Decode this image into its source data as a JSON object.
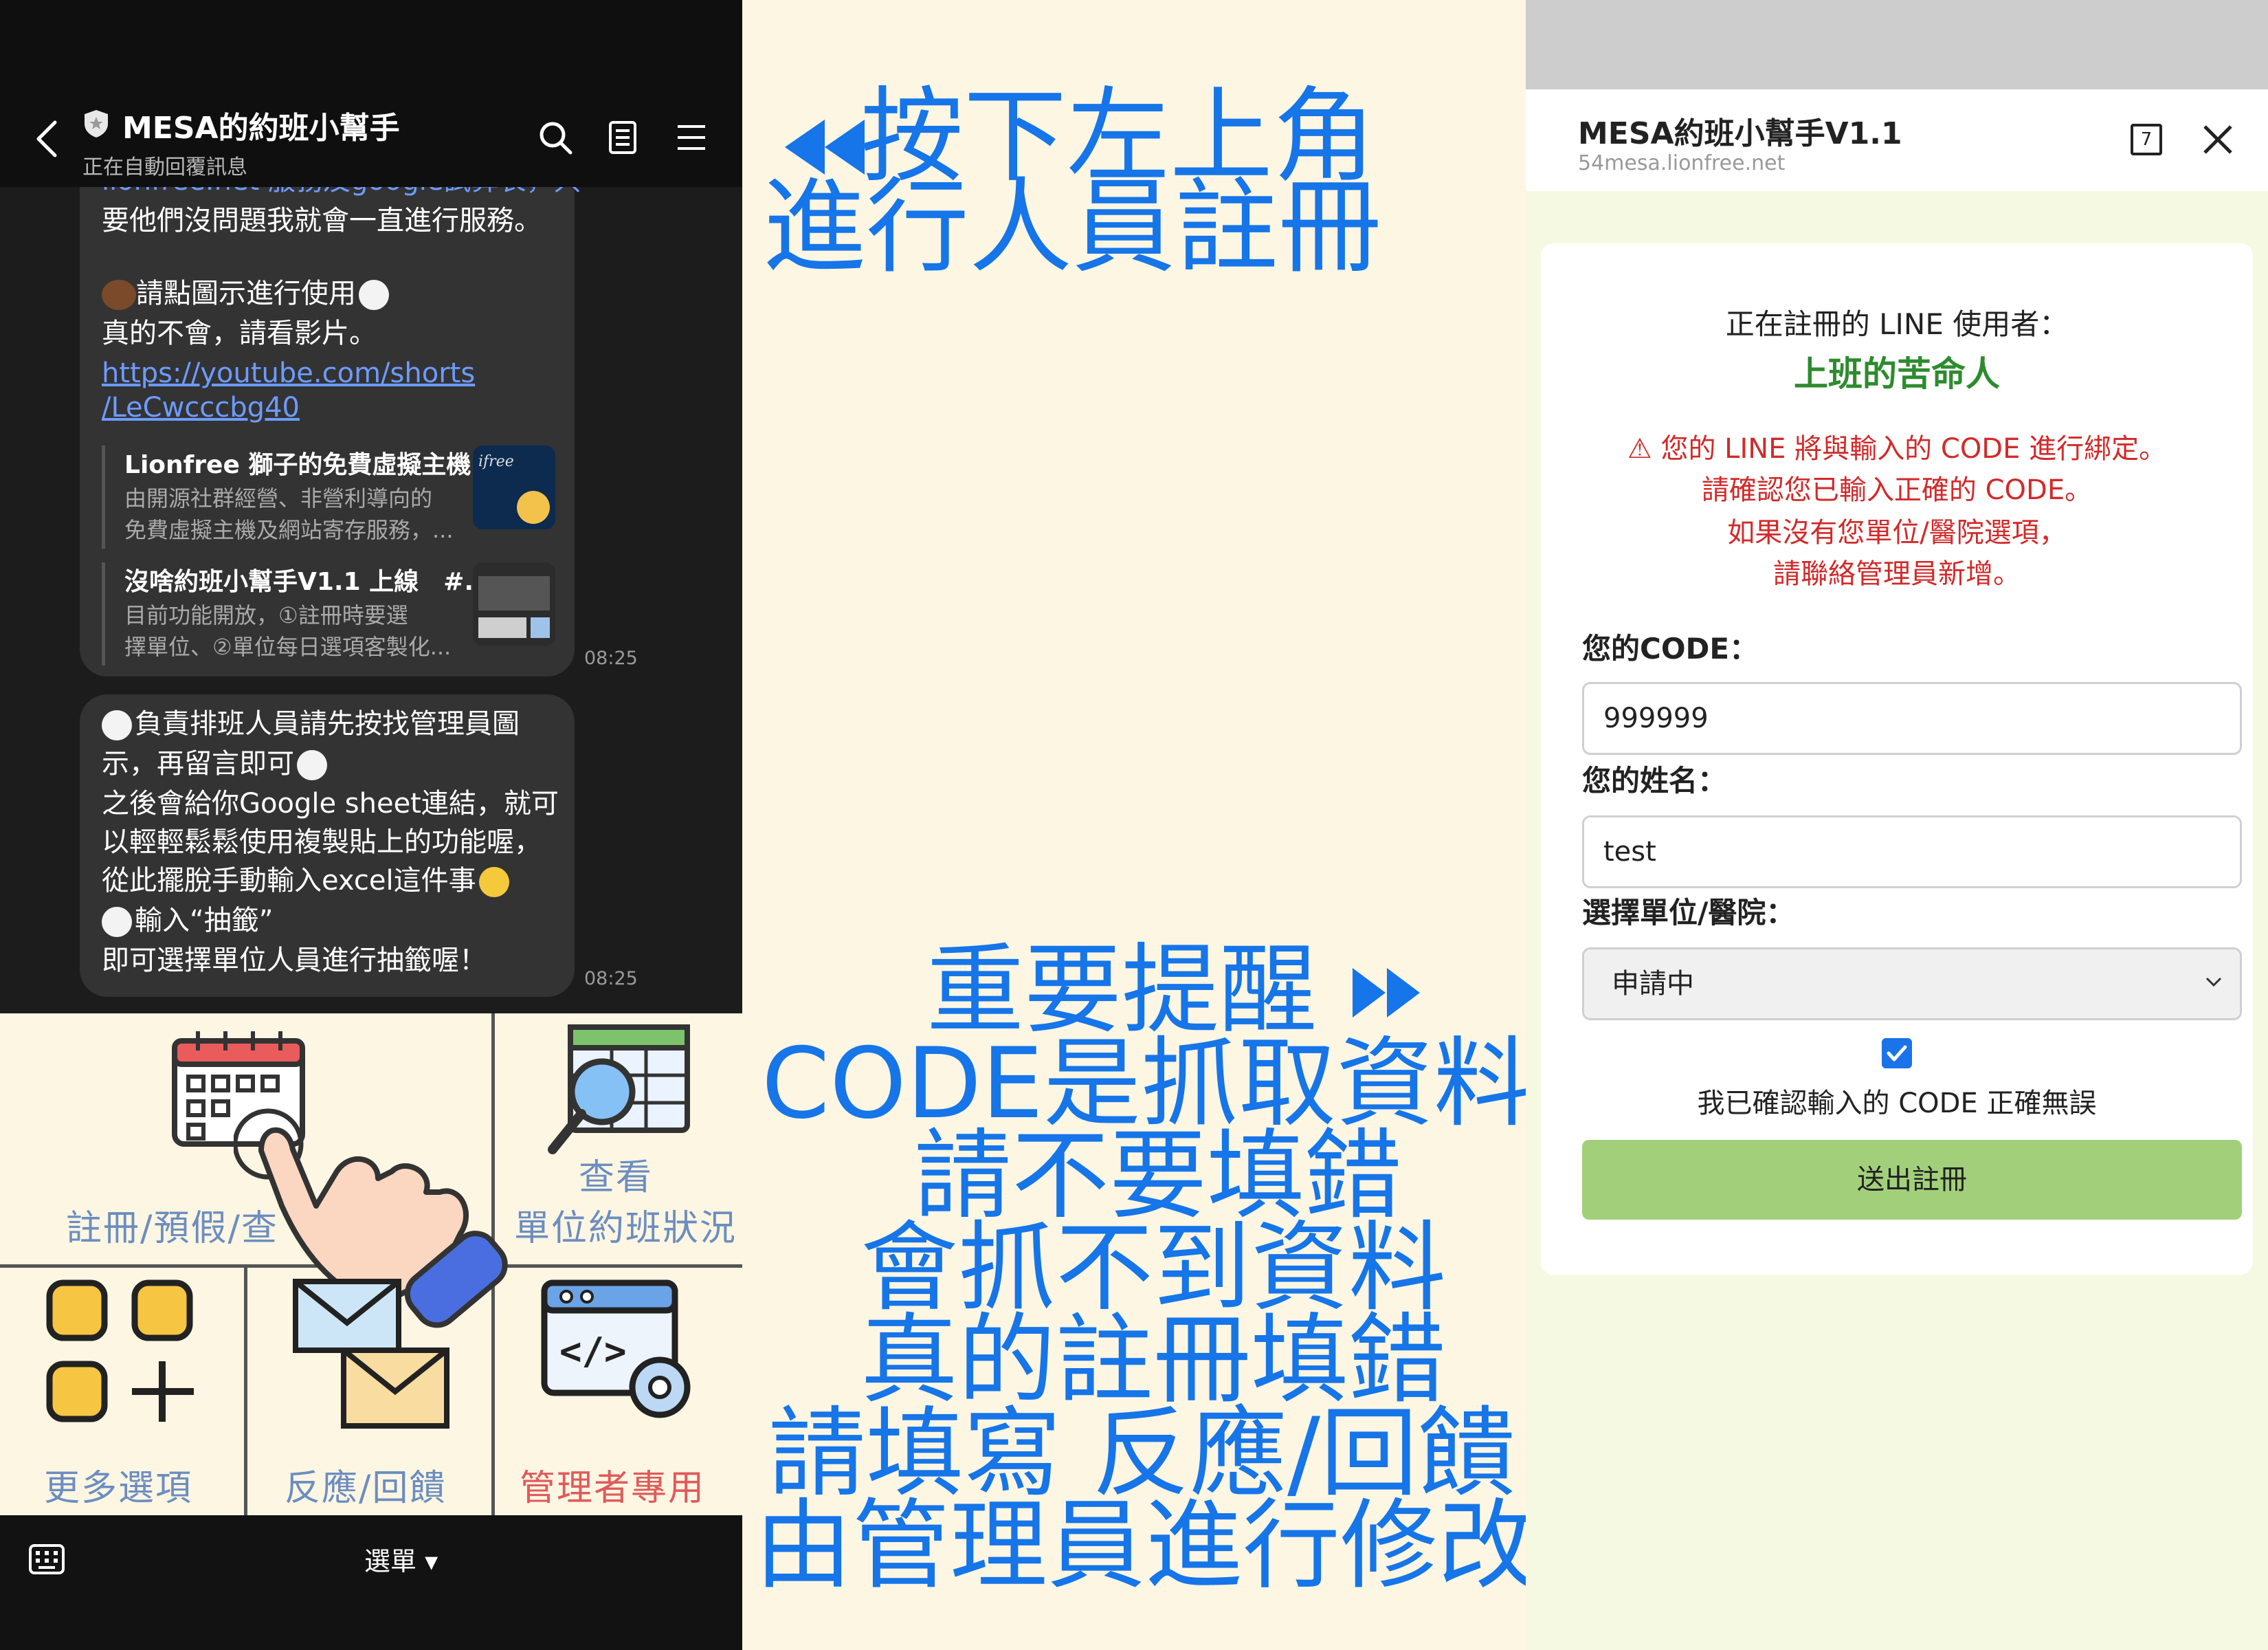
{
  "chat": {
    "title": "MESA的約班小幫手",
    "subtitle": "正在自動回覆訊息",
    "msg1_lines": [
      "lionfree.net 服務及google試算表，只",
      "要他們沒問題我就會一直進行服務。",
      "",
      "請點圖示進行使用",
      "真的不會，請看影片。"
    ],
    "link_lines": [
      "https://youtube.com/shorts",
      "/LeCwcccbg40"
    ],
    "preview1": {
      "title": "Lionfree 獅子的免費虛擬主機",
      "desc_lines": [
        "由開源社群經營、非營利導向的",
        "免費虛擬主機及網站寄存服務，..."
      ]
    },
    "preview2": {
      "title": "沒啥約班小幫手V1.1 上線　#...",
      "desc_lines": [
        "目前功能開放，①註冊時要選",
        "擇單位、②單位每日選項客製化..."
      ]
    },
    "time1": "08:25",
    "msg2_lines": [
      "負責排班人員請先按找管理員圖",
      "示，再留言即可",
      "之後會給你Google sheet連結，就可",
      "以輕輕鬆鬆使用複製貼上的功能喔，",
      "從此擺脫手動輸入excel這件事",
      "輸入“抽籤”",
      "即可選擇單位人員進行抽籤喔！"
    ],
    "time2": "08:25"
  },
  "richmenu": {
    "register": "註冊/預假/查",
    "view_status_line1": "查看",
    "view_status_line2": "單位約班狀況",
    "more": "更多選項",
    "feedback": "反應/回饋",
    "admin": "管理者專用",
    "menu_label": "選單 ▾"
  },
  "instructions": {
    "top_line1": "按下左上角",
    "top_line2": "進行人員註冊",
    "lines": [
      "重要提醒",
      "CODE是抓取資料",
      "請不要填錯",
      "會抓不到資料",
      "真的註冊填錯",
      "請填寫 反應/回饋",
      "由管理員進行修改"
    ]
  },
  "form": {
    "window_title": "MESA約班小幫手V1.1",
    "url": "54mesa.lionfree.net",
    "registering_label": "正在註冊的 LINE 使用者：",
    "user_name": "上班的苦命人",
    "warning_lines": [
      "您的 LINE 將與輸入的 CODE 進行綁定。",
      "請確認您已輸入正確的 CODE。",
      "如果沒有您單位/醫院選項，",
      "請聯絡管理員新增。"
    ],
    "code_label": "您的CODE：",
    "code_value": "999999",
    "name_label": "您的姓名：",
    "name_value": "test",
    "unit_label": "選擇單位/醫院：",
    "unit_value": "申請中",
    "confirm_label": "我已確認輸入的 CODE 正確無誤",
    "confirm_checked": true,
    "submit_label": "送出註冊",
    "tab_count": "7"
  },
  "colors": {
    "instruction_blue": "#1675e8",
    "user_name_green": "#2e8b2e",
    "warning_red": "#d22a2a",
    "submit_green": "#a2d07a",
    "richmenu_text": "#6c8dc0",
    "admin_text": "#e05a5a"
  }
}
